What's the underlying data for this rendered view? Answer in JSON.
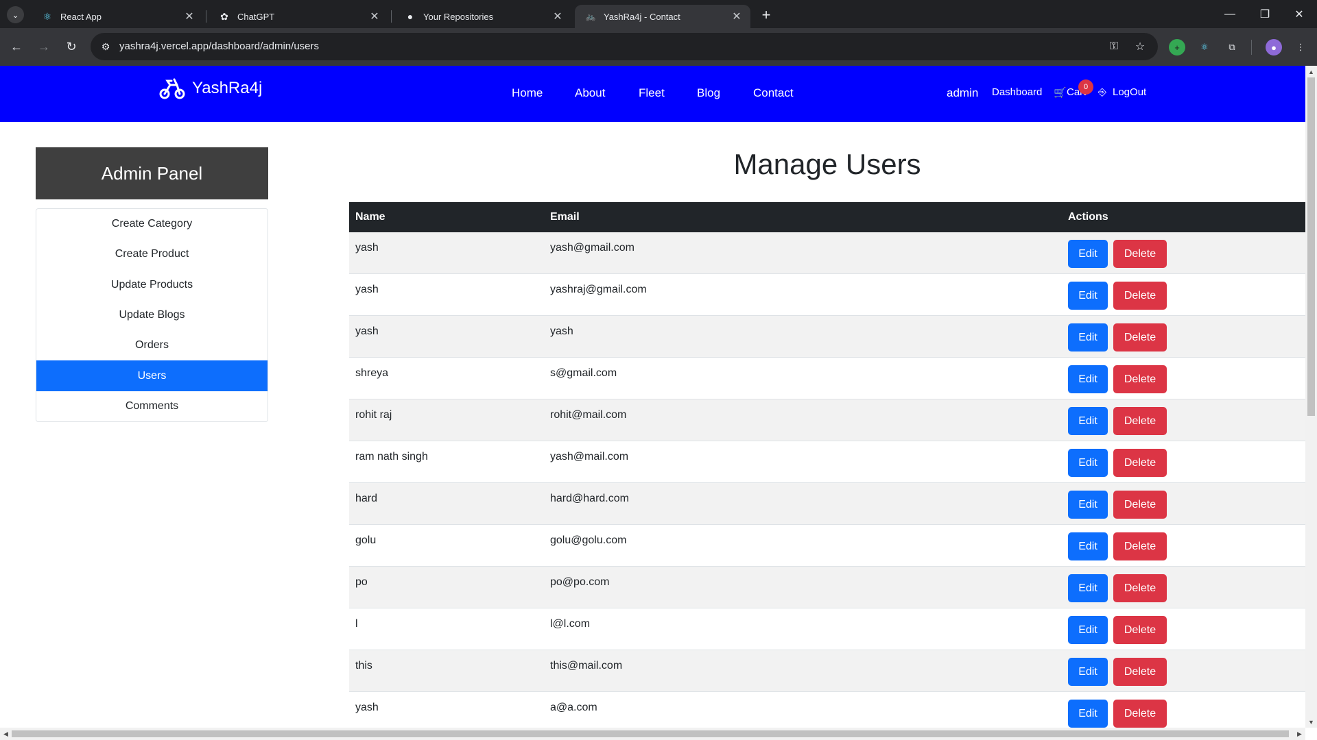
{
  "browser": {
    "tabs": [
      {
        "title": "React App",
        "icon": "react-icon"
      },
      {
        "title": "ChatGPT",
        "icon": "chatgpt-icon"
      },
      {
        "title": "Your Repositories",
        "icon": "github-icon"
      },
      {
        "title": "YashRa4j - Contact",
        "icon": "bike-icon",
        "active": true
      }
    ],
    "url": "yashra4j.vercel.app/dashboard/admin/users"
  },
  "site": {
    "brand": "YashRa4j",
    "nav": [
      "Home",
      "About",
      "Fleet",
      "Blog",
      "Contact"
    ],
    "user": "admin",
    "dashboard": "Dashboard",
    "cart": "Cart",
    "cart_count": "0",
    "logout": "LogOut"
  },
  "sidebar": {
    "title": "Admin Panel",
    "items": [
      "Create Category",
      "Create Product",
      "Update Products",
      "Update Blogs",
      "Orders",
      "Users",
      "Comments"
    ],
    "active": "Users"
  },
  "main": {
    "title": "Manage Users",
    "columns": [
      "Name",
      "Email",
      "Actions"
    ],
    "edit_label": "Edit",
    "delete_label": "Delete",
    "rows": [
      {
        "name": "yash",
        "email": "yash@gmail.com"
      },
      {
        "name": "yash",
        "email": "yashraj@gmail.com"
      },
      {
        "name": "yash",
        "email": "yash"
      },
      {
        "name": "shreya",
        "email": "s@gmail.com"
      },
      {
        "name": "rohit raj",
        "email": "rohit@mail.com"
      },
      {
        "name": "ram nath singh",
        "email": "yash@mail.com"
      },
      {
        "name": "hard",
        "email": "hard@hard.com"
      },
      {
        "name": "golu",
        "email": "golu@golu.com"
      },
      {
        "name": "po",
        "email": "po@po.com"
      },
      {
        "name": "l",
        "email": "l@l.com"
      },
      {
        "name": "this",
        "email": "this@mail.com"
      },
      {
        "name": "yash",
        "email": "a@a.com"
      }
    ]
  },
  "colors": {
    "navbar": "#0000ff",
    "primary": "#0d6efd",
    "danger": "#dc3545",
    "table_head": "#212529",
    "sidebar_head": "#3f3f3f"
  }
}
